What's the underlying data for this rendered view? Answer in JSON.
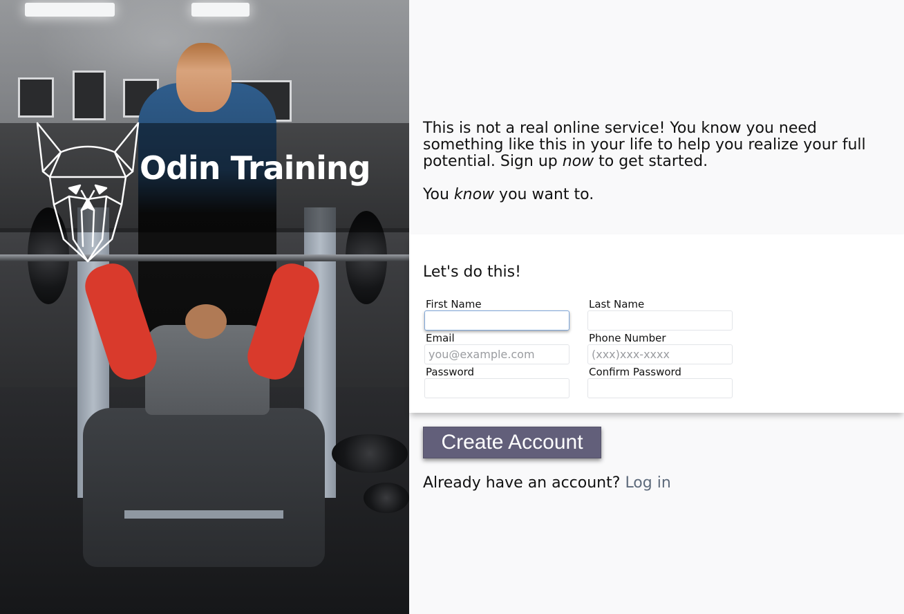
{
  "brand": {
    "title": "Odin Training",
    "logo_icon": "viking-helmet-icon"
  },
  "hero": {
    "image": "gym-bench-press-photo"
  },
  "intro": {
    "part1": "This is not a real online service! You know you need something like this in your life to help you realize your full potential. Sign up ",
    "emphasis1": "now",
    "part2": " to get started.",
    "line2_start": "You ",
    "emphasis2": "know",
    "line2_end": " you want to."
  },
  "form": {
    "heading": "Let's do this!",
    "first_name": {
      "label": "First Name",
      "value": "",
      "placeholder": ""
    },
    "last_name": {
      "label": "Last Name",
      "value": "",
      "placeholder": ""
    },
    "email": {
      "label": "Email",
      "value": "",
      "placeholder": "you@example.com"
    },
    "phone": {
      "label": "Phone Number",
      "value": "",
      "placeholder": "(xxx)xxx-xxxx"
    },
    "password": {
      "label": "Password",
      "value": "",
      "placeholder": ""
    },
    "confirm_password": {
      "label": "Confirm Password",
      "value": "",
      "placeholder": ""
    }
  },
  "actions": {
    "create_account_label": "Create Account",
    "login_prompt": "Already have an account?",
    "login_link": "Log in"
  },
  "colors": {
    "button_bg": "#625f7a",
    "link": "#5e6b7c",
    "panel_bg": "#f9f9fa",
    "form_bg": "#ffffff"
  }
}
